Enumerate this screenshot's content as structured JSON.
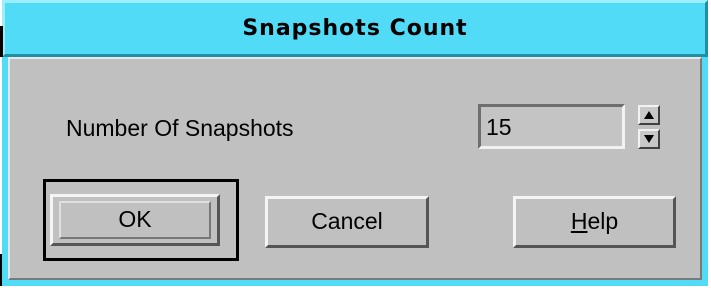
{
  "dialog": {
    "title": "Snapshots Count",
    "label": "Number Of Snapshots",
    "value": "15",
    "buttons": {
      "ok": "OK",
      "cancel": "Cancel",
      "help_mnemonic": "H",
      "help_rest": "elp"
    },
    "colors": {
      "titlebar": "#52dbf7",
      "body": "#c0c0c0"
    },
    "icons": {
      "spin_up": "arrow-up-icon",
      "spin_down": "arrow-down-icon"
    }
  }
}
